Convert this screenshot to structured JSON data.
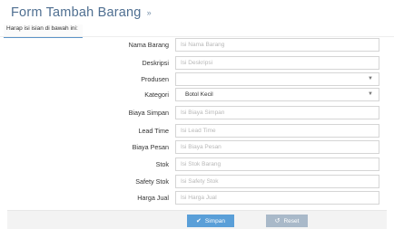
{
  "header": {
    "title": "Form Tambah Barang",
    "chevron_icon": "double-chevron-right-icon"
  },
  "info_tab": "Harap isi isian di bawah ini:",
  "fields": [
    {
      "label": "Nama Barang",
      "type": "text",
      "placeholder": "Isi Nama Barang"
    },
    {
      "label": "Deskripsi",
      "type": "text",
      "placeholder": "Isi Deskripsi"
    },
    {
      "label": "Produsen",
      "type": "select",
      "value": ""
    },
    {
      "label": "Kategori",
      "type": "select",
      "value": "Botol Kecil"
    },
    {
      "label": "Biaya Simpan",
      "type": "text",
      "placeholder": "Isi Biaya Simpan"
    },
    {
      "label": "Lead Time",
      "type": "text",
      "placeholder": "Isi Lead Time"
    },
    {
      "label": "Biaya Pesan",
      "type": "text",
      "placeholder": "Isi Biaya Pesan"
    },
    {
      "label": "Stok",
      "type": "text",
      "placeholder": "Isi Stok Barang"
    },
    {
      "label": "Safety Stok",
      "type": "text",
      "placeholder": "Isi Safety Stok"
    },
    {
      "label": "Harga Jual",
      "type": "text",
      "placeholder": "Isi Harga Jual"
    }
  ],
  "actions": {
    "save_label": "Simpan",
    "save_icon": "check-icon",
    "reset_label": "Reset",
    "reset_icon": "undo-icon"
  },
  "colors": {
    "title": "#4f6f91",
    "save_button": "#5a9fd8",
    "reset_button": "#a9b9c9"
  }
}
